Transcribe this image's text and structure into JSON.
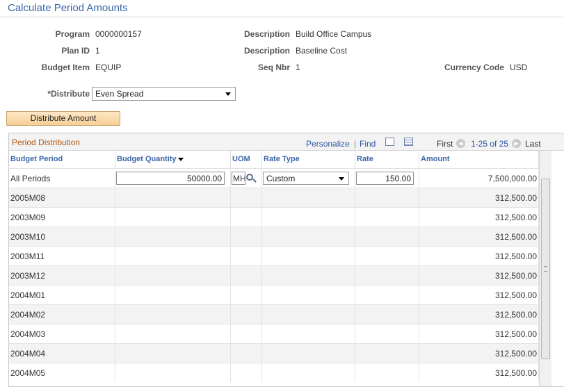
{
  "page": {
    "title": "Calculate Period Amounts"
  },
  "header": {
    "program_label": "Program",
    "program_value": "0000000157",
    "description1_label": "Description",
    "description1_value": "Build Office Campus",
    "plan_label": "Plan ID",
    "plan_value": "1",
    "description2_label": "Description",
    "description2_value": "Baseline Cost",
    "budget_item_label": "Budget Item",
    "budget_item_value": "EQUIP",
    "seq_label": "Seq Nbr",
    "seq_value": "1",
    "currency_label": "Currency Code",
    "currency_value": "USD"
  },
  "distribute": {
    "label": "*Distribute",
    "selected": "Even Spread"
  },
  "distribute_button": "Distribute Amount",
  "grid": {
    "title": "Period Distribution",
    "personalize": "Personalize",
    "separator": "|",
    "find": "Find",
    "first": "First",
    "range": "1-25 of 25",
    "last": "Last",
    "columns": {
      "budget_period": "Budget Period",
      "budget_quantity": "Budget Quantity",
      "uom": "UOM",
      "rate_type": "Rate Type",
      "rate": "Rate",
      "amount": "Amount"
    },
    "all_periods": {
      "period": "All Periods",
      "quantity": "50000.00",
      "uom": "MH",
      "rate_type": "Custom",
      "rate": "150.00",
      "amount": "7,500,000.00"
    },
    "rows": [
      {
        "period": "2005M08",
        "amount": "312,500.00"
      },
      {
        "period": "2003M09",
        "amount": "312,500.00"
      },
      {
        "period": "2003M10",
        "amount": "312,500.00"
      },
      {
        "period": "2003M11",
        "amount": "312,500.00"
      },
      {
        "period": "2003M12",
        "amount": "312,500.00"
      },
      {
        "period": "2004M01",
        "amount": "312,500.00"
      },
      {
        "period": "2004M02",
        "amount": "312,500.00"
      },
      {
        "period": "2004M03",
        "amount": "312,500.00"
      },
      {
        "period": "2004M04",
        "amount": "312,500.00"
      },
      {
        "period": "2004M05",
        "amount": "312,500.00"
      }
    ]
  },
  "icons": {
    "prev": "chevron-left-icon",
    "next": "chevron-right-icon",
    "view_all": "view-all-icon",
    "download": "spreadsheet-icon",
    "lookup": "magnifier-icon"
  }
}
